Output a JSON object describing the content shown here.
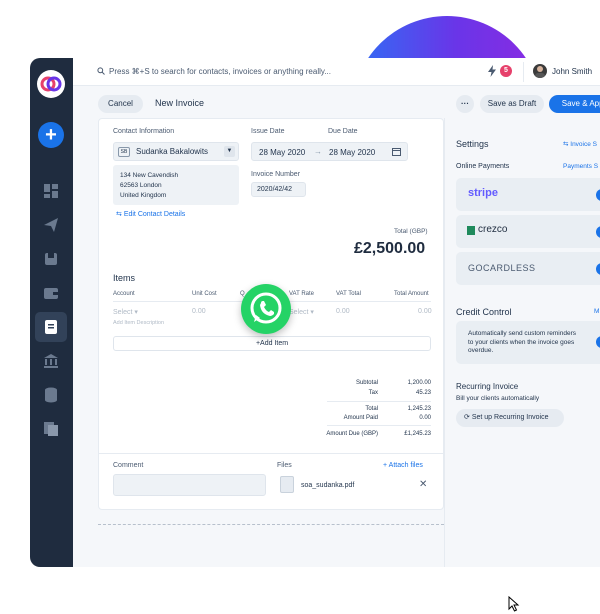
{
  "topbar": {
    "search_placeholder": "Press ⌘+S to search for contacts, invoices or anything really...",
    "notification_count": "5",
    "user_name": "John Smith"
  },
  "header": {
    "cancel_label": "Cancel",
    "title": "New Invoice",
    "more_label": "···",
    "draft_label": "Save as Draft",
    "approve_label": "Save & Appr"
  },
  "invoice": {
    "contact_label": "Contact Information",
    "contact_initials": "SB",
    "contact_name": "Sudanka Bakalowits",
    "address": [
      "134 New Cavendish",
      "62563 London",
      "United Kingdom"
    ],
    "edit_contact": "Edit Contact Details",
    "issue_date_label": "Issue Date",
    "due_date_label": "Due Date",
    "issue_date": "28 May 2020",
    "due_date": "28 May 2020",
    "invoice_number_label": "Invoice Number",
    "invoice_number": "2020/42/42",
    "total_label": "Total (GBP)",
    "total_amount": "£2,500.00"
  },
  "items": {
    "title": "Items",
    "columns": [
      "Account",
      "Unit Cost",
      "Q",
      "VAT Rate",
      "VAT Total",
      "Total Amount"
    ],
    "row": {
      "account": "Select",
      "unit_cost": "0.00",
      "vat_rate": "Select",
      "vat_total": "0.00",
      "total": "0.00"
    },
    "description_placeholder": "Add Item Description",
    "add_item": "+Add Item"
  },
  "summary": [
    {
      "label": "Subtotal",
      "value": "1,200.00"
    },
    {
      "label": "Tax",
      "value": "45.23"
    },
    {
      "label": "Total",
      "value": "1,245.23"
    },
    {
      "label": "Amount Paid",
      "value": "0.00"
    },
    {
      "label": "Amount Due (GBP)",
      "value": "£1,245.23"
    }
  ],
  "footer": {
    "comment_label": "Comment",
    "files_label": "Files",
    "attach_label": "+ Attach files",
    "file_name": "soa_sudanka.pdf"
  },
  "settings": {
    "title": "Settings",
    "invoice_link": "Invoice S",
    "online_payments": "Online Payments",
    "payments_link": "Payments S",
    "providers": [
      "stripe",
      "crezco",
      "GOCARDLESS"
    ],
    "credit_title": "Credit Control",
    "credit_link": "M",
    "credit_text": "Automatically send custom reminders to your clients when the invoice goes overdue.",
    "recurring_title": "Recurring Invoice",
    "recurring_sub": "Bill your clients automatically",
    "recurring_button": "Set up Recurring Invoice"
  },
  "colors": {
    "accent": "#1a73e8",
    "sidebar": "#1f2c3f",
    "whatsapp": "#25d366",
    "stripe": "#635bff",
    "crezco_green": "#1f8a5c"
  }
}
